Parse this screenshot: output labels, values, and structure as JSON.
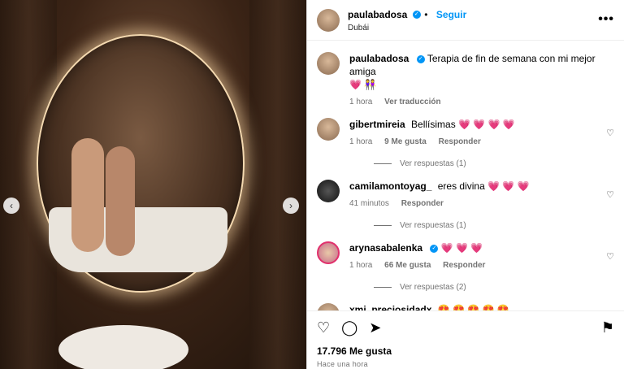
{
  "post": {
    "username": "paulabadosa",
    "follow_label": "Seguir",
    "location": "Dubái",
    "more_icon": "•••"
  },
  "caption": {
    "username": "paulabadosa",
    "text": "Terapia de fin de semana con mi mejor amiga",
    "emoji": "💗 👭",
    "time": "1 hora",
    "translate_label": "Ver traducción"
  },
  "comments": [
    {
      "username": "gibertmireia",
      "text": "Bellísimas",
      "emoji": "💗 💗 💗 💗",
      "time": "1 hora",
      "likes": "9 Me gusta",
      "reply": "Responder",
      "replies": "Ver respuestas (1)"
    },
    {
      "username": "camilamontoyag_",
      "text": "eres divina",
      "emoji": "💗 💗 💗",
      "time": "41 minutos",
      "likes": "",
      "reply": "Responder",
      "replies": "Ver respuestas (1)"
    },
    {
      "username": "arynasabalenka",
      "text": "",
      "emoji": "💗 💗 💗",
      "time": "1 hora",
      "likes": "66 Me gusta",
      "reply": "Responder",
      "replies": "Ver respuestas (2)"
    },
    {
      "username": "xmi_preciosidadx",
      "text": "",
      "emoji": "😍 😍 😍 😍 😍"
    }
  ],
  "footer": {
    "likes": "17.796 Me gusta",
    "time": "Hace una hora"
  },
  "colors": {
    "accent": "#0095f6",
    "verified": "#0095f6"
  }
}
